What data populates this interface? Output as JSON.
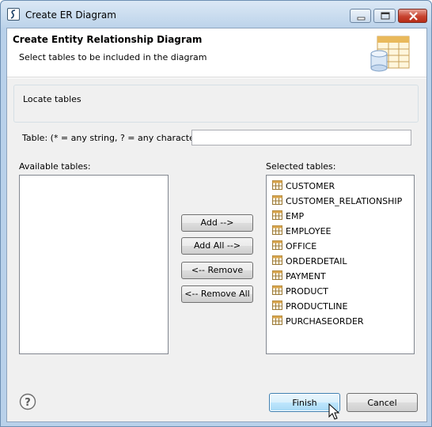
{
  "window": {
    "title": "Create ER Diagram"
  },
  "banner": {
    "title": "Create Entity Relationship Diagram",
    "description": "Select tables to be included in the diagram"
  },
  "locate": {
    "legend": "Locate tables",
    "label": "Table: (* = any string, ? = any character)",
    "value": ""
  },
  "available": {
    "label": "Available tables:",
    "items": []
  },
  "selected": {
    "label": "Selected tables:",
    "items": [
      "CUSTOMER",
      "CUSTOMER_RELATIONSHIP",
      "EMP",
      "EMPLOYEE",
      "OFFICE",
      "ORDERDETAIL",
      "PAYMENT",
      "PRODUCT",
      "PRODUCTLINE",
      "PURCHASEORDER"
    ]
  },
  "buttons": {
    "add": "Add -->",
    "add_all": "Add All -->",
    "remove": "<-- Remove",
    "remove_all": "<-- Remove All",
    "finish": "Finish",
    "cancel": "Cancel"
  },
  "colors": {
    "titlebar": "#bcd3ea",
    "dialog_bg": "#f0f0f0",
    "close_button": "#c7432f",
    "default_button": "#bee6fd"
  }
}
